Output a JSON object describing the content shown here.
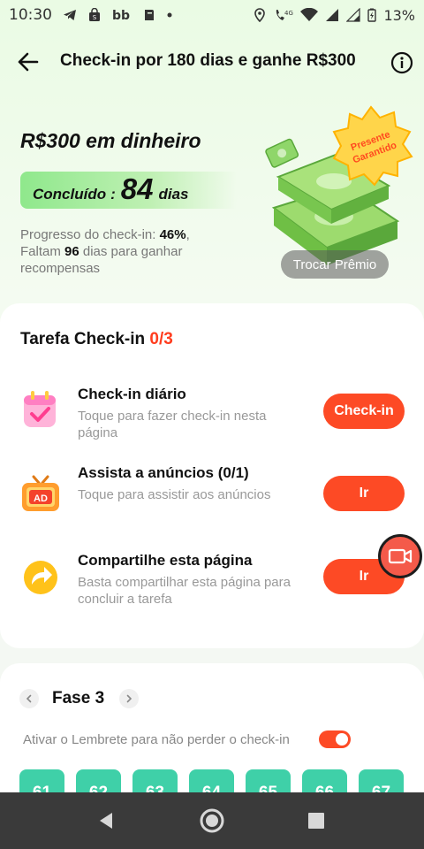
{
  "status_bar": {
    "time": "10:30",
    "network": "4G",
    "battery": "13%"
  },
  "header": {
    "title": "Check-in por 180 dias e ganhe R$300"
  },
  "hero": {
    "reward_title": "R$300 em dinheiro",
    "completed_label": "Concluído",
    "completed_colon": ":",
    "completed_days": "84",
    "completed_unit": "dias",
    "progress_prefix": "Progresso do check-in: ",
    "progress_value": "46%",
    "progress_suffix": ",",
    "remaining_prefix": "Faltam ",
    "remaining_value": "96",
    "remaining_suffix": " dias para ganhar recompensas",
    "badge_line1": "Presente",
    "badge_line2": "Garantido",
    "swap_button": "Trocar Prêmio"
  },
  "tasks": {
    "title": "Tarefa Check-in",
    "count": "0/3",
    "items": [
      {
        "name": "Check-in diário",
        "desc": "Toque para fazer check-in nesta página",
        "button": "Check-in",
        "icon": "calendar-check-icon"
      },
      {
        "name": "Assista a anúncios  (0/1)",
        "desc": "Toque para assistir aos anúncios",
        "button": "Ir",
        "icon": "tv-ad-icon",
        "icon_text": "AD"
      },
      {
        "name": "Compartilhe esta página",
        "desc": "Basta compartilhar esta página para concluir a tarefa",
        "button": "Ir",
        "icon": "share-arrow-icon"
      }
    ]
  },
  "phase": {
    "title": "Fase 3",
    "reminder": "Ativar o Lembrete para não perder o check-in",
    "reminder_on": true,
    "days": [
      "61",
      "62",
      "63",
      "64",
      "65",
      "66",
      "67"
    ]
  },
  "colors": {
    "accent": "#fd4a25",
    "tile": "#3fd0a8",
    "navbar": "#3a3a3a"
  }
}
